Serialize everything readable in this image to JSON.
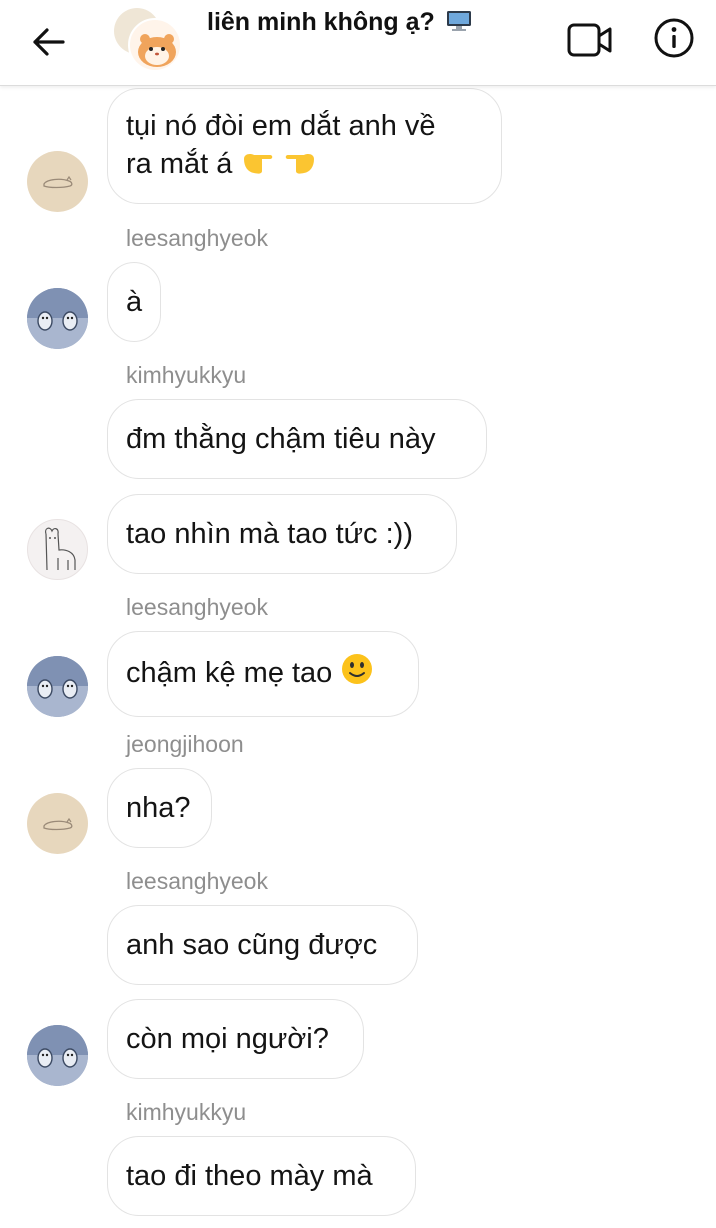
{
  "header": {
    "title": "liên minh không ạ?",
    "title_emoji": "computer-icon",
    "back_icon": "back-arrow-icon",
    "video_icon": "video-call-icon",
    "info_icon": "info-icon"
  },
  "messages": [
    {
      "id": "m1",
      "sender": "",
      "text_line1": "tụi nó đòi em dắt anh về",
      "text_line2": "ra mắt á",
      "emoji": "pointing-hands-emoji",
      "avatar": "avatar-sleeping-cat"
    },
    {
      "id": "m2",
      "sender": "leesanghyeok",
      "text": "à",
      "avatar": "avatar-penguins"
    },
    {
      "id": "m3",
      "sender": "kimhyukkyu",
      "text": "đm thằng chậm tiêu này",
      "avatar": ""
    },
    {
      "id": "m4",
      "sender": "",
      "text": "tao nhìn mà tao tức :))",
      "avatar": "avatar-llama"
    },
    {
      "id": "m5",
      "sender": "leesanghyeok",
      "text": "chậm kệ mẹ tao",
      "emoji": "smiley-emoji",
      "avatar": "avatar-penguins"
    },
    {
      "id": "m6",
      "sender": "jeongjihoon",
      "text": "nha?",
      "avatar": "avatar-sleeping-cat"
    },
    {
      "id": "m7",
      "sender": "leesanghyeok",
      "text": "anh sao cũng được",
      "avatar": ""
    },
    {
      "id": "m8",
      "sender": "",
      "text": "còn mọi người?",
      "avatar": "avatar-penguins"
    },
    {
      "id": "m9",
      "sender": "kimhyukkyu",
      "text": "tao đi theo mày mà",
      "avatar": ""
    }
  ],
  "colors": {
    "bubble_border": "#e3e3e3",
    "sender_text": "#8e8e8e",
    "header_border": "#dcdcdc"
  }
}
